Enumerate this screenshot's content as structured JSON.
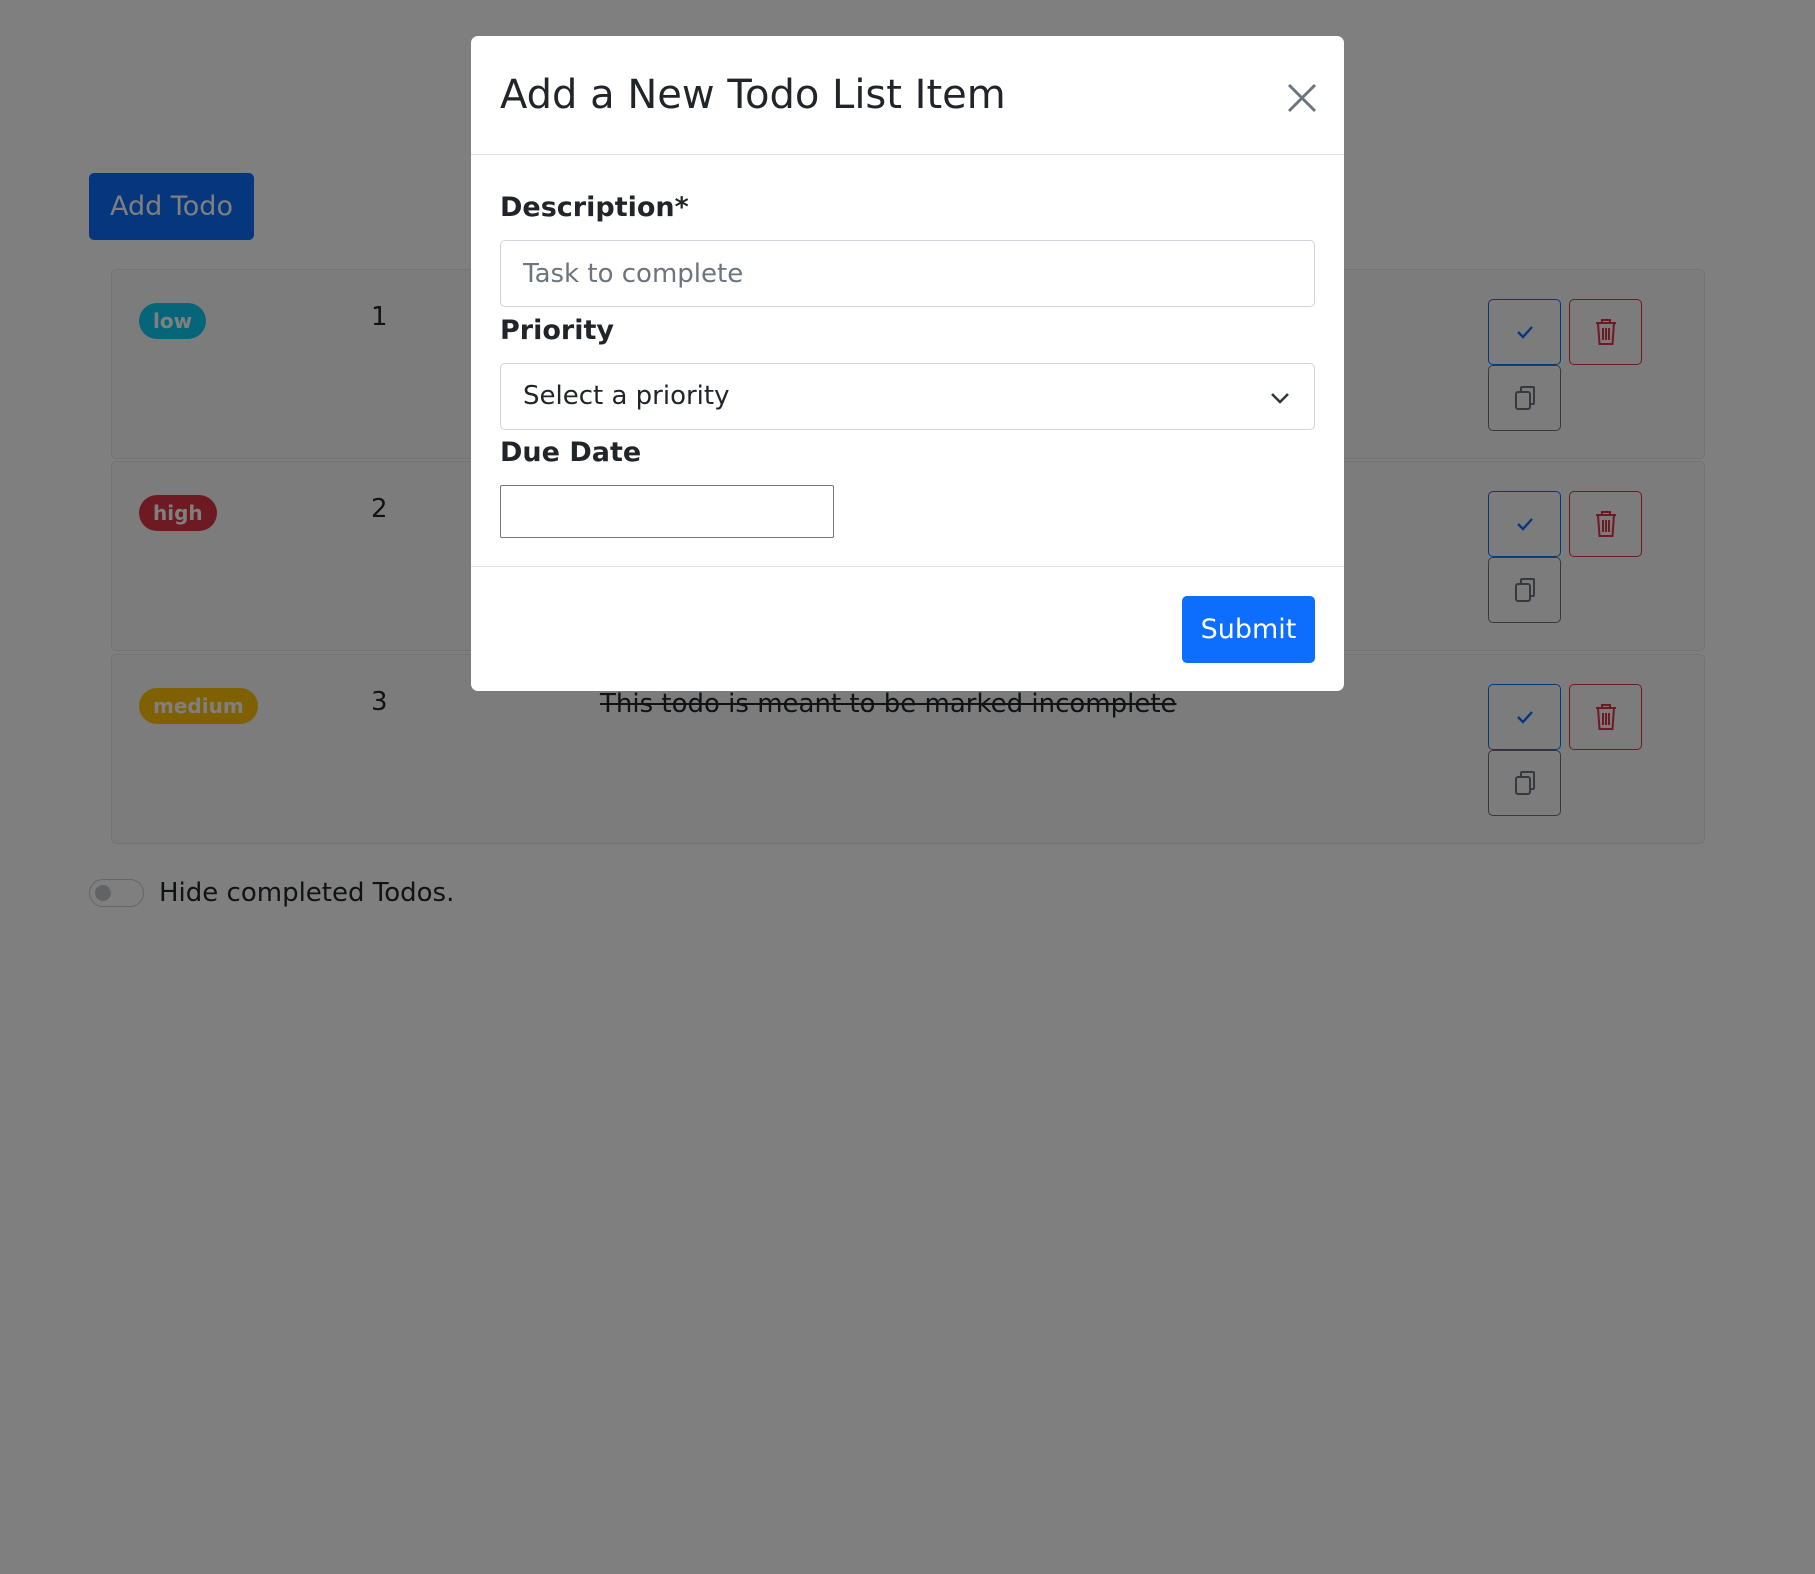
{
  "page": {
    "add_todo_label": "Add Todo",
    "todos": [
      {
        "priority": "low",
        "number": "1",
        "description": ""
      },
      {
        "priority": "high",
        "number": "2",
        "description": ""
      },
      {
        "priority": "medium",
        "number": "3",
        "description": "This todo is meant to be marked incomplete"
      }
    ],
    "hide_completed_label": "Hide completed Todos.",
    "hide_completed_on": false
  },
  "modal": {
    "title": "Add a New Todo List Item",
    "description_label": "Description*",
    "description_placeholder": "Task to complete",
    "description_value": "",
    "priority_label": "Priority",
    "priority_selected": "Select a priority",
    "due_date_label": "Due Date",
    "due_date_value": "",
    "submit_label": "Submit"
  },
  "colors": {
    "primary": "#0d6efd",
    "danger": "#dc3545",
    "info": "#0dcaf0",
    "warning": "#ffc107",
    "secondary": "#6c757d"
  },
  "icons": {
    "close": "close-icon",
    "check": "check-icon",
    "trash": "trash-icon",
    "copy": "copy-icon",
    "chevron": "chevron-down-icon"
  }
}
